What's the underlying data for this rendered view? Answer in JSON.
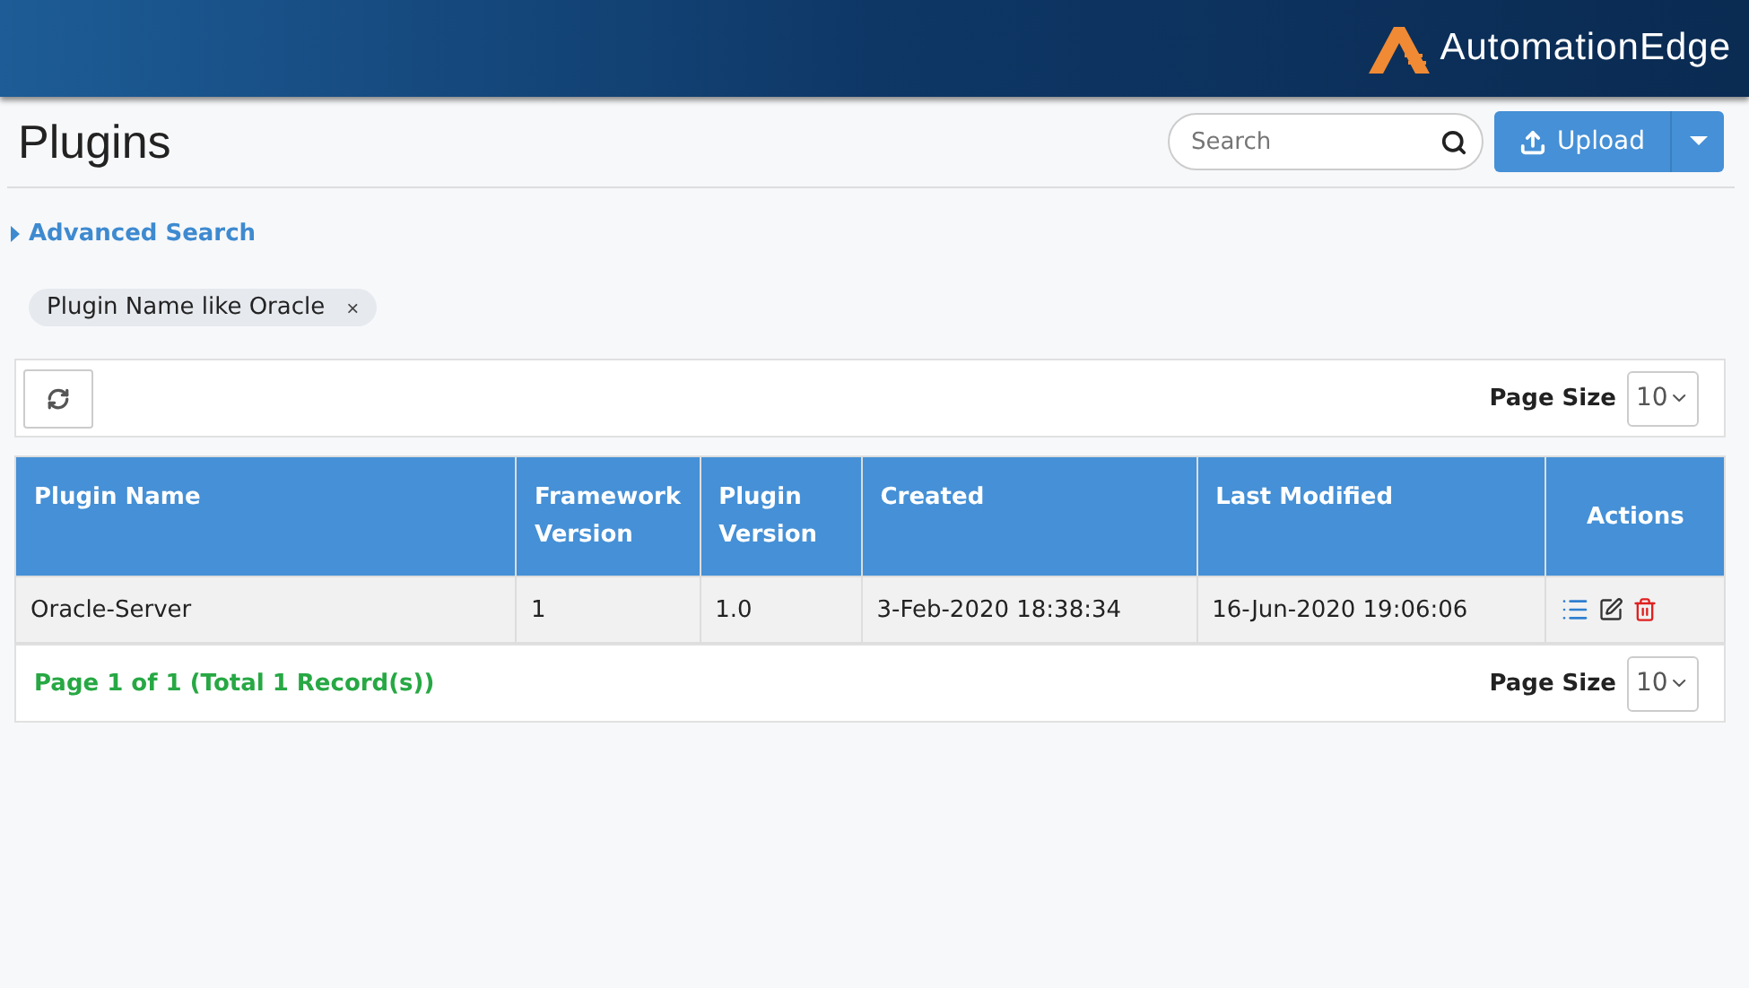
{
  "header": {
    "logo": "AutomationEdge"
  },
  "page": {
    "title": "Plugins"
  },
  "search": {
    "placeholder": "Search"
  },
  "upload_button": {
    "label": "Upload"
  },
  "advanced_search": {
    "label": "Advanced Search",
    "expanded": false
  },
  "filters": [
    {
      "label": "Plugin Name like Oracle",
      "remove": "×"
    }
  ],
  "toolbar": {
    "page_size_label": "Page Size",
    "page_size": "10"
  },
  "table": {
    "columns": [
      "Plugin Name",
      "Framework Version",
      "Plugin Version",
      "Created",
      "Last Modified",
      "Actions"
    ],
    "rows": [
      {
        "cells": [
          "Oracle-Server",
          "1",
          "1.0",
          "3-Feb-2020 18:38:34",
          "16-Jun-2020 19:06:06"
        ]
      }
    ]
  },
  "footer": {
    "summary": "Page 1 of 1 (Total 1 Record(s))",
    "page_size_label": "Page Size",
    "page_size": "10"
  }
}
